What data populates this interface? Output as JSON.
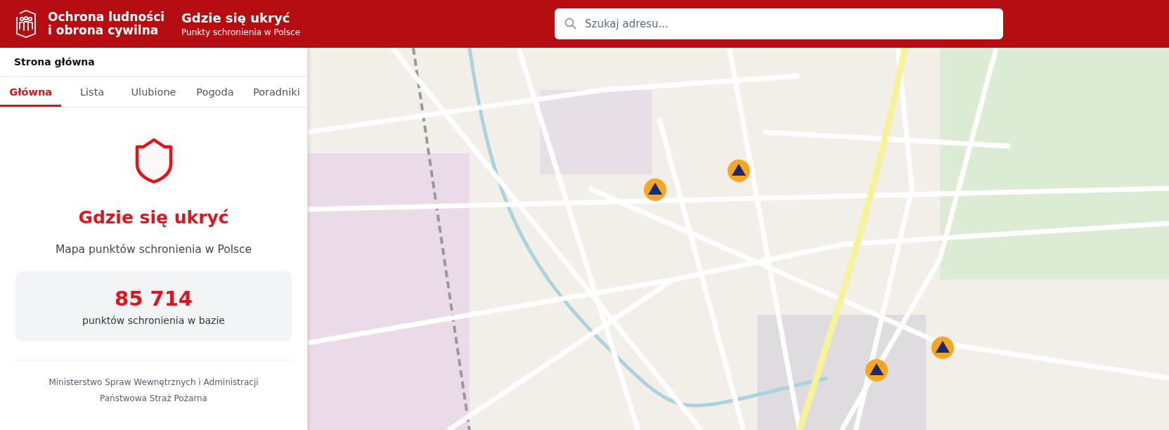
{
  "header": {
    "brand": [
      "Ochrona ludności",
      "i obrona cywilna"
    ],
    "title": "Gdzie się ukryć",
    "subtitle": "Punkty schronienia w Polsce"
  },
  "search": {
    "placeholder": "Szukaj adresu..."
  },
  "sidebar": {
    "breadcrumb": "Strona główna",
    "tabs": [
      {
        "label": "Główna",
        "selected": true
      },
      {
        "label": "Lista",
        "selected": false
      },
      {
        "label": "Ulubione",
        "selected": false
      },
      {
        "label": "Pogoda",
        "selected": false
      },
      {
        "label": "Poradniki",
        "selected": false
      }
    ],
    "heading": "Gdzie się ukryć",
    "description": "Mapa punktów schronienia w Polsce",
    "stat": {
      "value": "85 714",
      "label": "punktów schronienia w bazie"
    },
    "footer": [
      "Ministerstwo Spraw Wewnętrznych i Administracji",
      "Państwowa Straż Pożarna"
    ]
  }
}
